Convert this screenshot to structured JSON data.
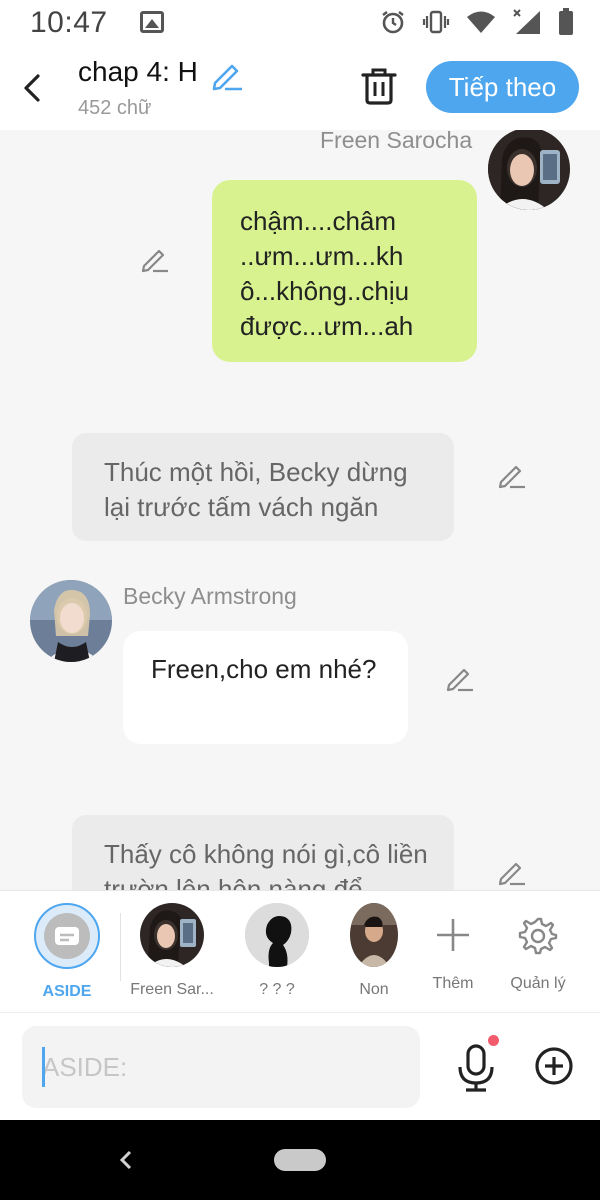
{
  "status_bar": {
    "time": "10:47"
  },
  "header": {
    "title": "chap 4: H",
    "word_count": "452 chữ",
    "next_label": "Tiếp theo"
  },
  "messages": [
    {
      "type": "character",
      "side": "right",
      "speaker": "Freen Sarocha",
      "text": "chậm....châm ..ưm...ưm...kh ô...không..chịu được...ưm...ah",
      "bubble_color": "#d7f28e"
    },
    {
      "type": "aside",
      "text": "Thúc một hồi, Becky dừng lại trước tấm vách ngăn"
    },
    {
      "type": "character",
      "side": "left",
      "speaker": "Becky Armstrong",
      "text": "Freen,cho em nhé?",
      "bubble_color": "#ffffff"
    },
    {
      "type": "aside",
      "text": "Thấy cô không nói gì,cô liền trườn lên hôn nàng để"
    }
  ],
  "characters": [
    {
      "label": "ASIDE",
      "selected": true
    },
    {
      "label": "Freen Sar..."
    },
    {
      "label": "? ? ?"
    },
    {
      "label": "Non"
    }
  ],
  "char_actions": {
    "add_label": "Thêm",
    "manage_label": "Quản lý"
  },
  "composer": {
    "placeholder": "ASIDE:"
  },
  "colors": {
    "accent": "#4ea6ee",
    "green_bubble": "#d7f28e",
    "notification_dot": "#f25b6b"
  }
}
